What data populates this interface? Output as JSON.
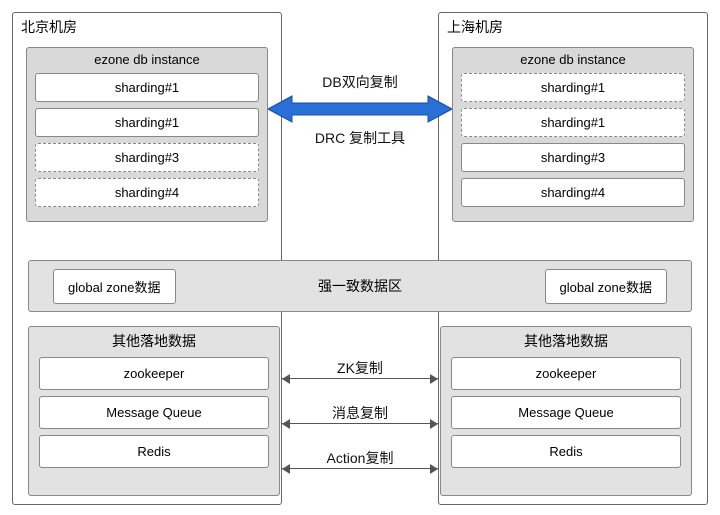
{
  "dc": {
    "left": {
      "title": "北京机房"
    },
    "right": {
      "title": "上海机房"
    }
  },
  "ezone": {
    "title": "ezone db instance",
    "left_shards": [
      "sharding#1",
      "sharding#1",
      "sharding#3",
      "sharding#4"
    ],
    "right_shards": [
      "sharding#1",
      "sharding#1",
      "sharding#3",
      "sharding#4"
    ]
  },
  "db_repl": {
    "line1": "DB双向复制",
    "line2": "DRC 复制工具"
  },
  "global": {
    "box": "global zone数据",
    "label": "强一致数据区"
  },
  "other": {
    "title": "其他落地数据",
    "items": [
      "zookeeper",
      "Message Queue",
      "Redis"
    ]
  },
  "repl_labels": {
    "zk": "ZK复制",
    "mq": "消息复制",
    "action": "Action复制"
  }
}
